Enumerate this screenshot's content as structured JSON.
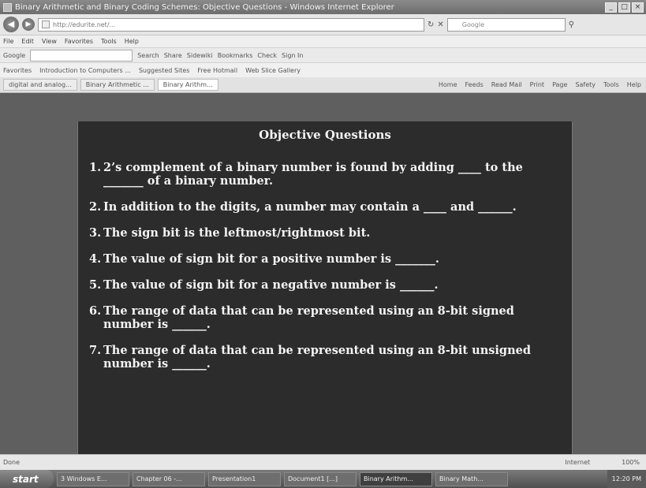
{
  "window": {
    "title": "Binary Arithmetic and Binary Coding Schemes: Objective Questions - Windows Internet Explorer",
    "controls": [
      "_",
      "□",
      "×"
    ]
  },
  "address_bar": {
    "url": "http://edurite.net/...",
    "search_placeholder": "Google"
  },
  "menu": [
    "File",
    "Edit",
    "View",
    "Favorites",
    "Tools",
    "Help"
  ],
  "google_toolbar": {
    "label": "Google",
    "items": [
      "Search",
      "Share",
      "Sidewiki",
      "Bookmarks",
      "Check",
      "Sign In"
    ]
  },
  "favorites_bar": {
    "label": "Favorites",
    "items": [
      "Introduction to Computers ...",
      "Suggested Sites",
      "Free Hotmail",
      "Web Slice Gallery"
    ]
  },
  "tabs": [
    "digital and analog...",
    "Binary Arithmetic ...",
    "Binary Arithm..."
  ],
  "command_bar": [
    "Home",
    "Feeds",
    "Read Mail",
    "Print",
    "Page",
    "Safety",
    "Tools",
    "Help"
  ],
  "slide": {
    "title": "Objective Questions",
    "questions": [
      {
        "num": "1.",
        "text": "2’s complement of a binary number is found by adding ____ to the _______ of a binary number."
      },
      {
        "num": "2.",
        "text": "In addition to the digits, a number may contain a ____ and ______."
      },
      {
        "num": "3.",
        "text": "The sign bit is the leftmost/rightmost bit."
      },
      {
        "num": "4.",
        "text": "The value of sign bit for a positive number is _______."
      },
      {
        "num": "5.",
        "text": "The value of sign bit for a negative number is ______."
      },
      {
        "num": "6.",
        "text": "The range of data that can be represented using an 8-bit signed number is ______."
      },
      {
        "num": "7.",
        "text": "The range of data that can be represented using an 8-bit unsigned number is ______."
      }
    ]
  },
  "status": {
    "left": "Done",
    "zone": "Internet",
    "zoom": "100%"
  },
  "taskbar": {
    "start": "start",
    "tasks": [
      "3 Windows E...",
      "Chapter 06 -...",
      "Presentation1",
      "Document1 [...]",
      "Binary Arithm...",
      "Binary Math..."
    ],
    "clock": "12:20 PM"
  }
}
